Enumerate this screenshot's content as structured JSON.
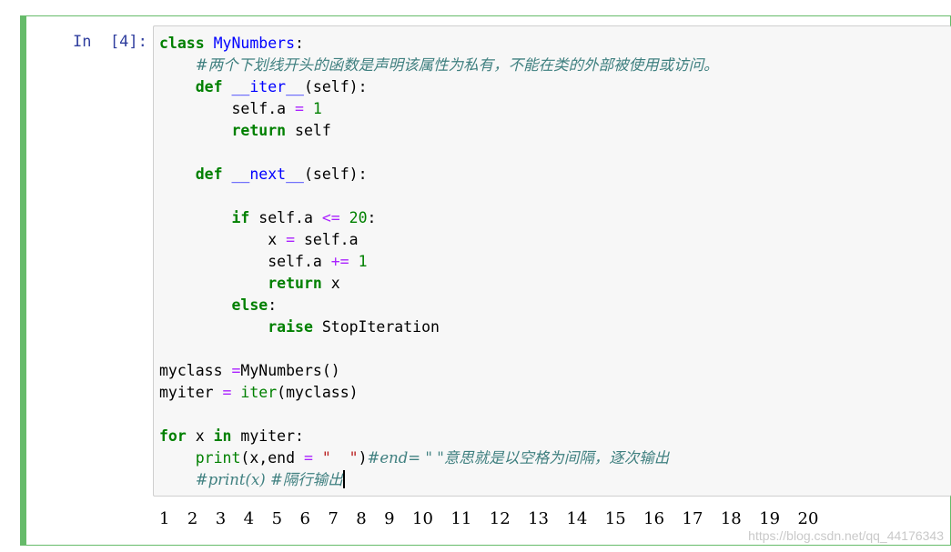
{
  "cell": {
    "prompt": "In  [4]:",
    "code_lines": [
      [
        {
          "t": "class",
          "c": "kw"
        },
        {
          "t": " "
        },
        {
          "t": "MyNumbers",
          "c": "cls"
        },
        {
          "t": ":"
        }
      ],
      [
        {
          "t": "    "
        },
        {
          "t": "#两个下划线开头的函数是声明该属性为私有，不能在类的外部被使用或访问。",
          "c": "cm"
        }
      ],
      [
        {
          "t": "    "
        },
        {
          "t": "def",
          "c": "kw"
        },
        {
          "t": " "
        },
        {
          "t": "__iter__",
          "c": "fn"
        },
        {
          "t": "(self):"
        }
      ],
      [
        {
          "t": "        self.a "
        },
        {
          "t": "=",
          "c": "op"
        },
        {
          "t": " "
        },
        {
          "t": "1",
          "c": "num"
        }
      ],
      [
        {
          "t": "        "
        },
        {
          "t": "return",
          "c": "kw"
        },
        {
          "t": " self"
        }
      ],
      [
        {
          "t": ""
        }
      ],
      [
        {
          "t": "    "
        },
        {
          "t": "def",
          "c": "kw"
        },
        {
          "t": " "
        },
        {
          "t": "__next__",
          "c": "fn"
        },
        {
          "t": "(self):"
        }
      ],
      [
        {
          "t": ""
        }
      ],
      [
        {
          "t": "        "
        },
        {
          "t": "if",
          "c": "kw"
        },
        {
          "t": " self.a "
        },
        {
          "t": "<=",
          "c": "op"
        },
        {
          "t": " "
        },
        {
          "t": "20",
          "c": "num"
        },
        {
          "t": ":"
        }
      ],
      [
        {
          "t": "            x "
        },
        {
          "t": "=",
          "c": "op"
        },
        {
          "t": " self.a"
        }
      ],
      [
        {
          "t": "            self.a "
        },
        {
          "t": "+=",
          "c": "op"
        },
        {
          "t": " "
        },
        {
          "t": "1",
          "c": "num"
        }
      ],
      [
        {
          "t": "            "
        },
        {
          "t": "return",
          "c": "kw"
        },
        {
          "t": " x"
        }
      ],
      [
        {
          "t": "        "
        },
        {
          "t": "else",
          "c": "kw"
        },
        {
          "t": ":"
        }
      ],
      [
        {
          "t": "            "
        },
        {
          "t": "raise",
          "c": "kw"
        },
        {
          "t": " StopIteration"
        }
      ],
      [
        {
          "t": ""
        }
      ],
      [
        {
          "t": "myclass "
        },
        {
          "t": "=",
          "c": "op"
        },
        {
          "t": "MyNumbers()"
        }
      ],
      [
        {
          "t": "myiter "
        },
        {
          "t": "=",
          "c": "op"
        },
        {
          "t": " "
        },
        {
          "t": "iter",
          "c": "bi"
        },
        {
          "t": "(myclass)"
        }
      ],
      [
        {
          "t": ""
        }
      ],
      [
        {
          "t": "for",
          "c": "kw"
        },
        {
          "t": " x "
        },
        {
          "t": "in",
          "c": "kw"
        },
        {
          "t": " myiter:"
        }
      ],
      [
        {
          "t": "    "
        },
        {
          "t": "print",
          "c": "bi"
        },
        {
          "t": "(x,end "
        },
        {
          "t": "=",
          "c": "op"
        },
        {
          "t": " "
        },
        {
          "t": "\"  \"",
          "c": "str"
        },
        {
          "t": ")"
        },
        {
          "t": "#end= \" \"意思就是以空格为间隔，逐次输出",
          "c": "cm"
        }
      ],
      [
        {
          "t": "    "
        },
        {
          "t": "#print(x) #隔行输出",
          "c": "cm"
        },
        {
          "cursor": true
        }
      ]
    ],
    "output": "1  2  3  4  5  6  7  8  9  10  11  12  13  14  15  16  17  18  19  20"
  },
  "watermark": "https://blog.csdn.net/qq_44176343",
  "colors": {
    "cell_border": "#66bb6a",
    "prompt": "#303f9f",
    "keyword": "#008000",
    "class_name": "#0000ff",
    "comment": "#408080",
    "operator": "#aa22ff",
    "input_bg": "#f7f7f7"
  }
}
